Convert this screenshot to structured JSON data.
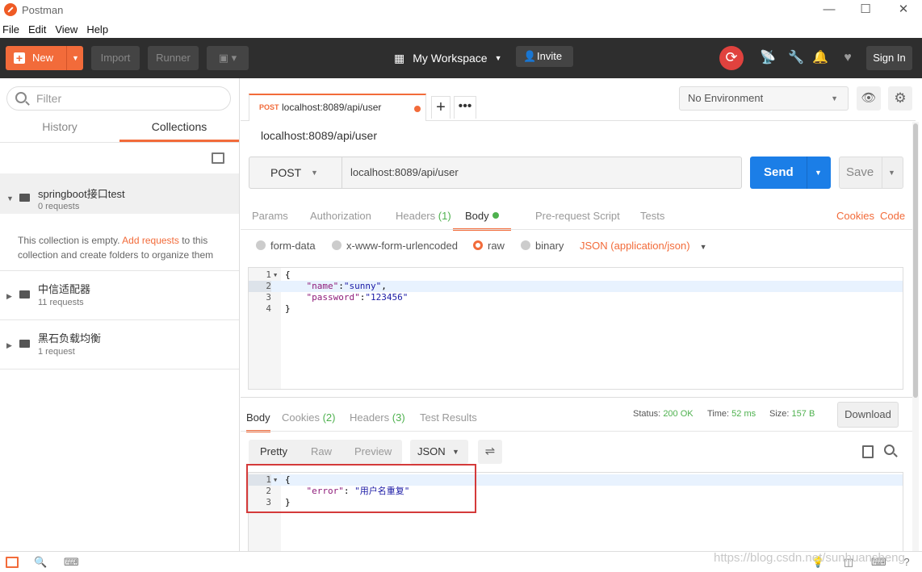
{
  "window": {
    "title": "Postman",
    "minimize": "—",
    "maximize": "☐",
    "close": "✕"
  },
  "menu": [
    "File",
    "Edit",
    "View",
    "Help"
  ],
  "header": {
    "new_label": "New",
    "import_label": "Import",
    "runner_label": "Runner",
    "workspace_label": "My Workspace",
    "invite_label": "Invite",
    "signin_label": "Sign In"
  },
  "sidebar": {
    "filter_placeholder": "Filter",
    "tabs": [
      "History",
      "Collections"
    ],
    "collections": [
      {
        "name": "springboot接口test",
        "count": "0 requests"
      },
      {
        "name": "中信适配器",
        "count": "11 requests"
      },
      {
        "name": "黑石负载均衡",
        "count": "1 request"
      }
    ],
    "empty_before": "This collection is empty. ",
    "empty_link": "Add requests",
    "empty_after": " to this collection and create folders to organize them"
  },
  "tab": {
    "method": "POST",
    "url": "localhost:8089/api/user"
  },
  "environment": "No Environment",
  "request": {
    "title": "localhost:8089/api/user",
    "method": "POST",
    "url": "localhost:8089/api/user",
    "send_label": "Send",
    "save_label": "Save",
    "tabs": {
      "params": "Params",
      "authorization": "Authorization",
      "headers": "Headers",
      "headers_count": "(1)",
      "body": "Body",
      "prerequest": "Pre-request Script",
      "tests": "Tests"
    },
    "cookies_link": "Cookies",
    "code_link": "Code",
    "body_types": [
      "form-data",
      "x-www-form-urlencoded",
      "raw",
      "binary"
    ],
    "content_type": "JSON (application/json)",
    "body_lines": [
      {
        "n": "1",
        "text": "{"
      },
      {
        "n": "2",
        "key": "\"name\"",
        "val": "\"sunny\""
      },
      {
        "n": "3",
        "key": "\"password\"",
        "val": "\"123456\""
      },
      {
        "n": "4",
        "text": "}"
      }
    ]
  },
  "response": {
    "tabs": {
      "body": "Body",
      "cookies": "Cookies",
      "cookies_count": "(2)",
      "headers": "Headers",
      "headers_count": "(3)",
      "tests": "Test Results"
    },
    "status_label": "Status:",
    "status_value": "200 OK",
    "time_label": "Time:",
    "time_value": "52 ms",
    "size_label": "Size:",
    "size_value": "157 B",
    "download_label": "Download",
    "views": [
      "Pretty",
      "Raw",
      "Preview"
    ],
    "format": "JSON",
    "body_lines": [
      {
        "n": "1",
        "text": "{"
      },
      {
        "n": "2",
        "key": "\"error\"",
        "val": "\"用户名重复\""
      },
      {
        "n": "3",
        "text": "}"
      }
    ]
  },
  "watermark": "https://blog.csdn.net/sunhuansheng",
  "colors": {
    "accent": "#f26b3a",
    "send": "#1b7ee7",
    "ok": "#4eb14e",
    "highlight_box": "#d43a3a"
  }
}
